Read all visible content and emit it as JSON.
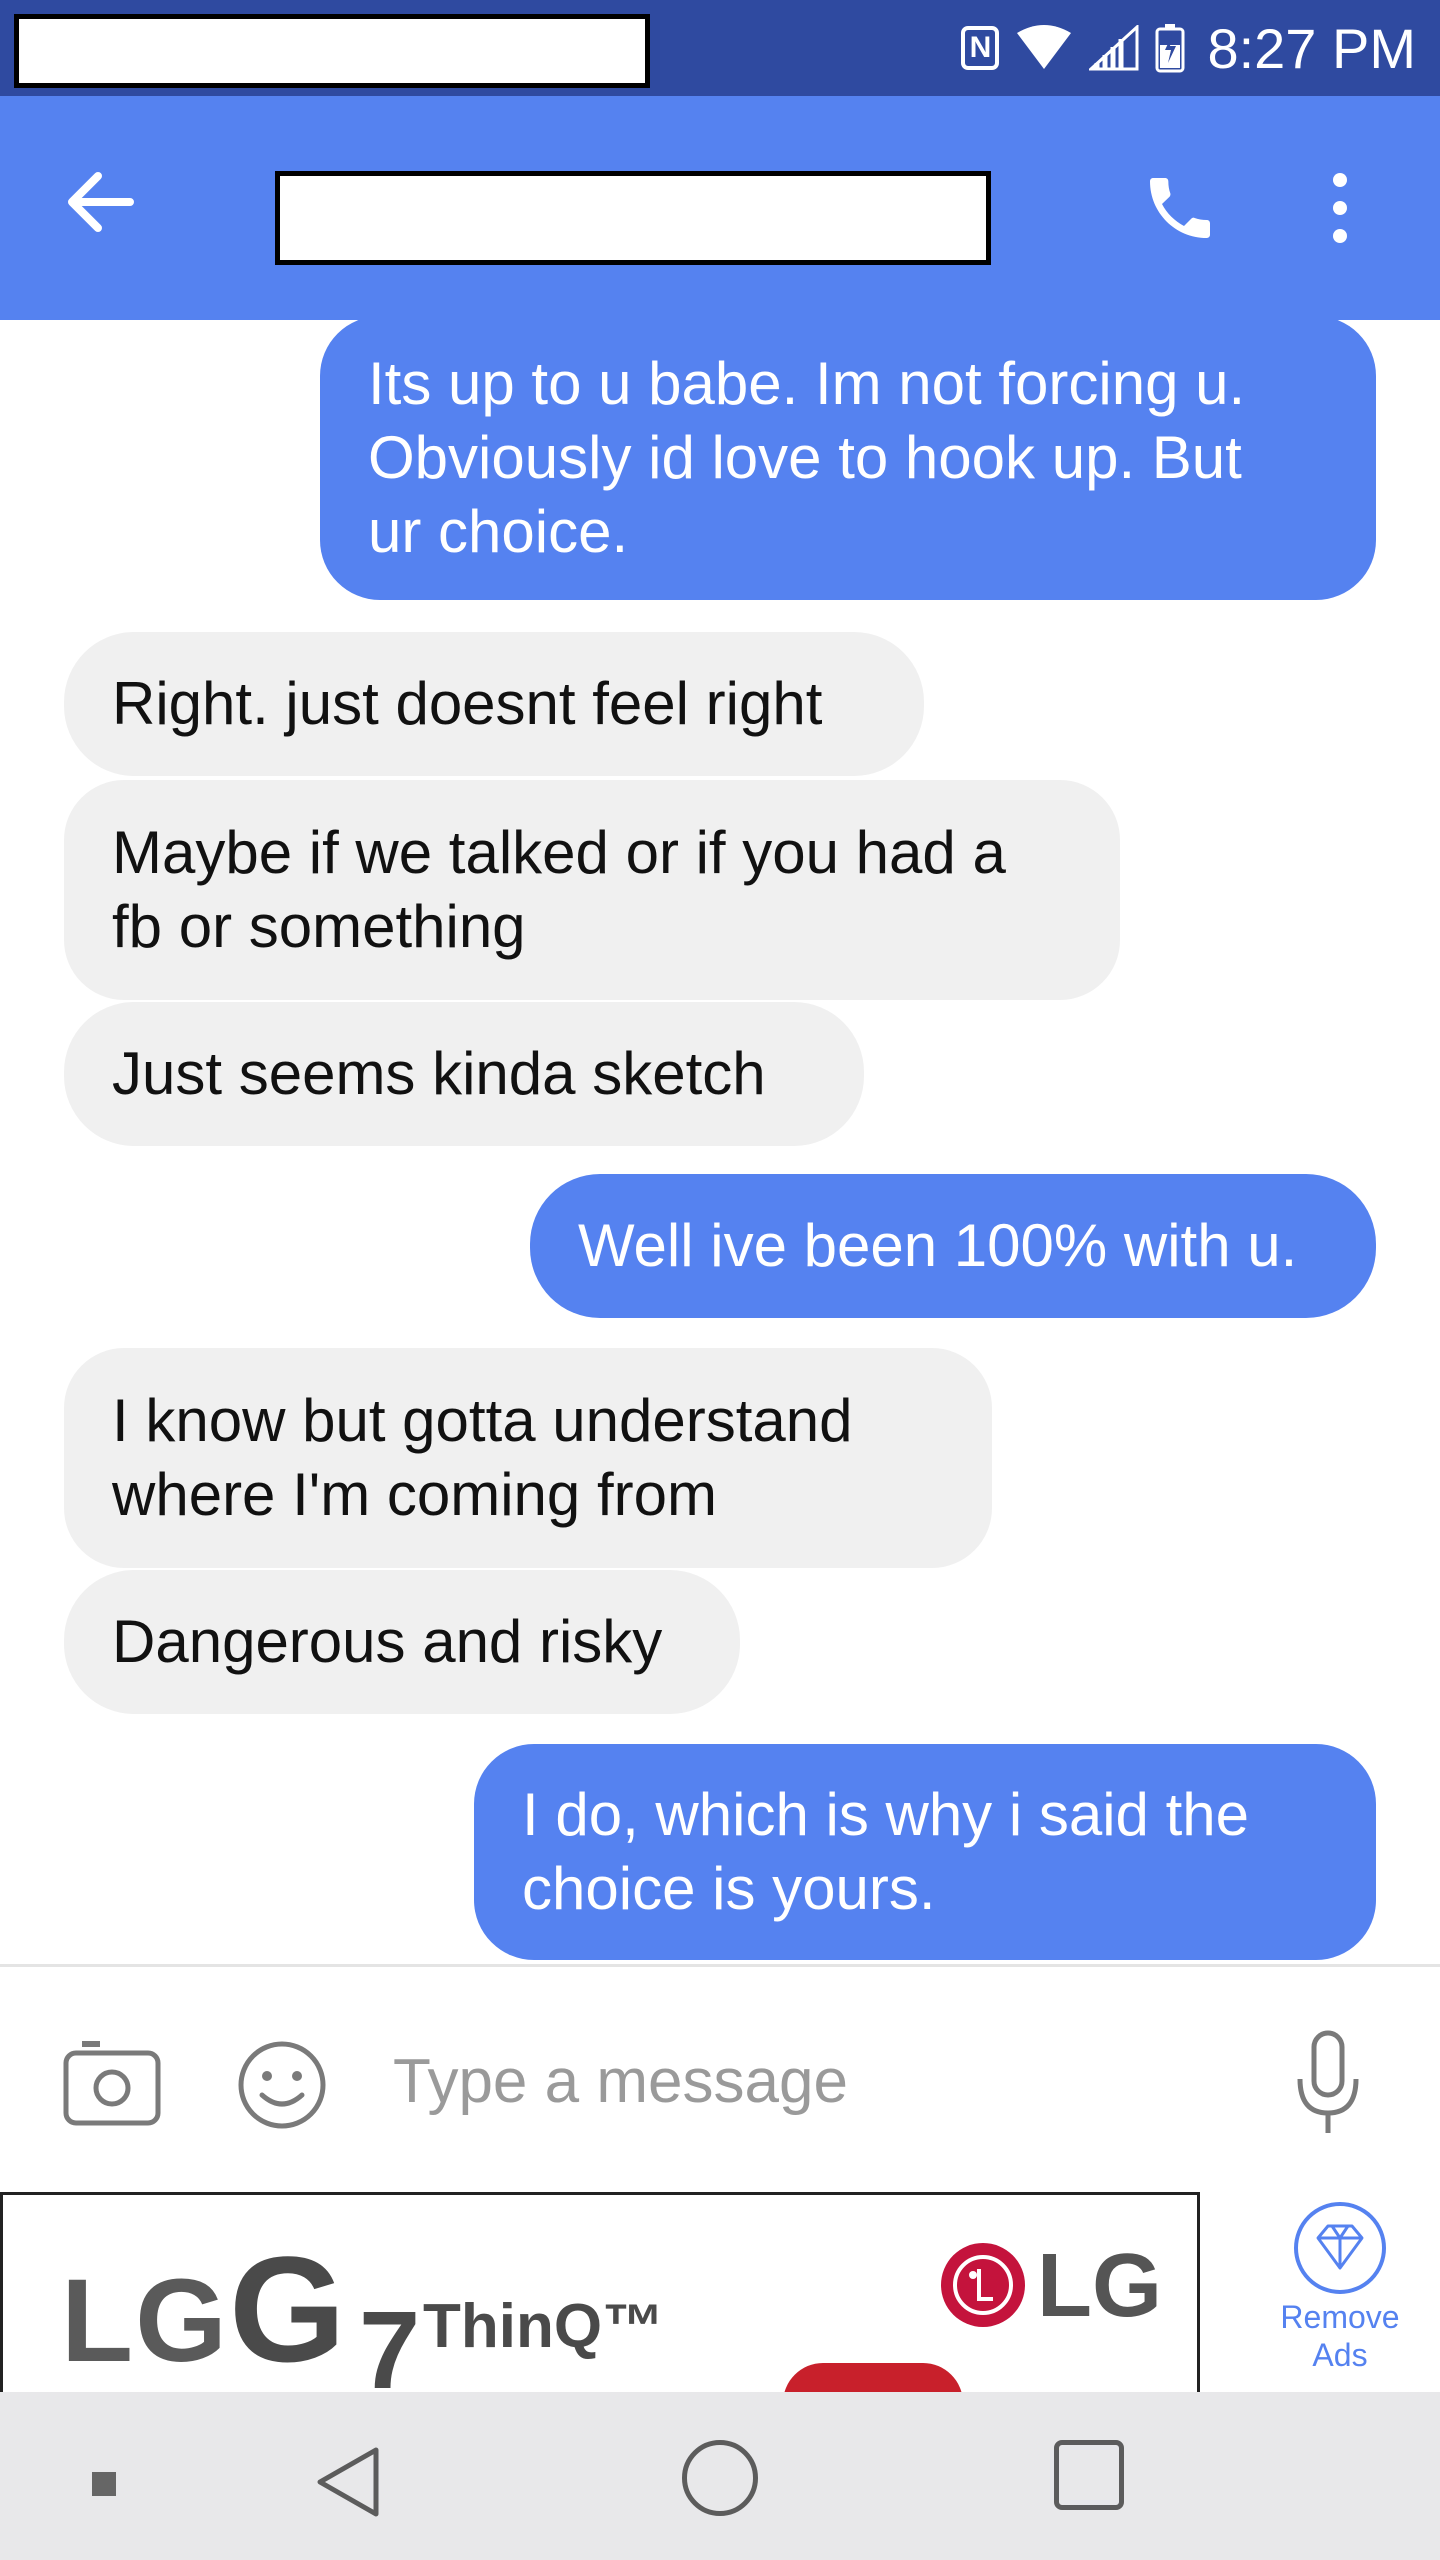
{
  "status_bar": {
    "time": "8:27 PM",
    "icons": [
      "nfc-icon",
      "wifi-icon",
      "signal-icon",
      "battery-charging-icon"
    ]
  },
  "app_bar": {
    "back_icon": "back-arrow-icon",
    "call_icon": "phone-icon",
    "more_icon": "more-vert-icon"
  },
  "messages": [
    {
      "direction": "out",
      "lines": [
        "Its up to u babe. Im not forcing u.",
        "Obviously id love to hook up. But",
        "ur choice."
      ]
    },
    {
      "direction": "in",
      "lines": [
        "Right. just doesnt feel right"
      ]
    },
    {
      "direction": "in",
      "lines": [
        "Maybe if we talked or if you had a",
        "fb or something"
      ]
    },
    {
      "direction": "in",
      "lines": [
        "Just seems kinda sketch"
      ]
    },
    {
      "direction": "out",
      "lines": [
        "Well ive been 100% with u."
      ]
    },
    {
      "direction": "in",
      "lines": [
        "I know but gotta understand",
        "where I'm coming from"
      ]
    },
    {
      "direction": "in",
      "lines": [
        "Dangerous and risky"
      ]
    },
    {
      "direction": "out",
      "lines": [
        "I do, which is why i said the",
        "choice is yours."
      ]
    }
  ],
  "composer": {
    "placeholder": "Type a message",
    "camera_icon": "camera-icon",
    "emoji_icon": "emoji-icon",
    "mic_icon": "microphone-icon"
  },
  "ad": {
    "brand_left": "LG",
    "model_g": "G",
    "model_number": "7",
    "model_suffix": "ThinQ™",
    "brand_right": "LG",
    "remove_ads_label": "Remove Ads"
  },
  "colors": {
    "status_bar": "#2f4aa0",
    "accent": "#5582f0",
    "incoming_bubble": "#f0f0f0",
    "nav_bar": "#e8e8ea"
  }
}
